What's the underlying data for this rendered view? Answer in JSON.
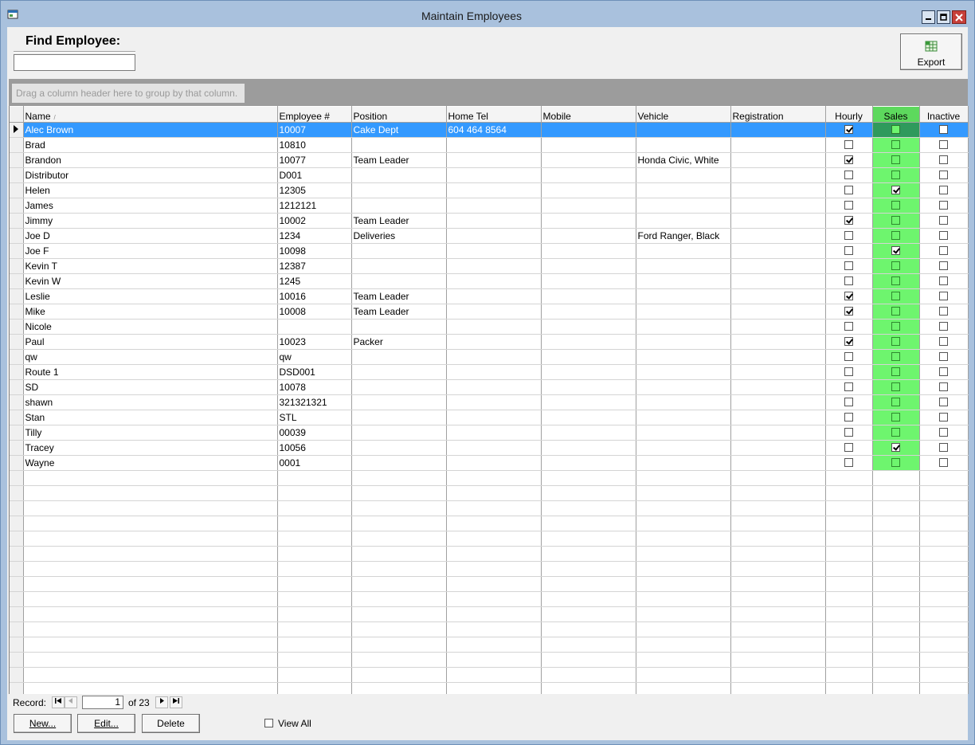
{
  "window": {
    "title": "Maintain Employees",
    "app_icon": "app-window-icon"
  },
  "find": {
    "label": "Find Employee:",
    "value": ""
  },
  "export": {
    "label": "Export",
    "icon": "spreadsheet-export-icon"
  },
  "group_hint": "Drag a column header here to group by that column.",
  "columns": {
    "name": "Name",
    "emp": "Employee #",
    "position": "Position",
    "home": "Home Tel",
    "mobile": "Mobile",
    "vehicle": "Vehicle",
    "registration": "Registration",
    "hourly": "Hourly",
    "sales": "Sales",
    "inactive": "Inactive"
  },
  "sort": {
    "column": "Name",
    "direction": "ascending"
  },
  "rows": [
    {
      "name": "Alec Brown",
      "emp": "10007",
      "position": "Cake Dept",
      "home": "604 464 8564",
      "mobile": "",
      "vehicle": "",
      "registration": "",
      "hourly": true,
      "sales": false,
      "inactive": false,
      "selected": true
    },
    {
      "name": "Brad",
      "emp": "10810",
      "position": "",
      "home": "",
      "mobile": "",
      "vehicle": "",
      "registration": "",
      "hourly": false,
      "sales": false,
      "inactive": false
    },
    {
      "name": "Brandon",
      "emp": "10077",
      "position": "Team Leader",
      "home": "",
      "mobile": "",
      "vehicle": "Honda Civic, White",
      "registration": "",
      "hourly": true,
      "sales": false,
      "inactive": false
    },
    {
      "name": "Distributor",
      "emp": "D001",
      "position": "",
      "home": "",
      "mobile": "",
      "vehicle": "",
      "registration": "",
      "hourly": false,
      "sales": false,
      "inactive": false
    },
    {
      "name": "Helen",
      "emp": "12305",
      "position": "",
      "home": "",
      "mobile": "",
      "vehicle": "",
      "registration": "",
      "hourly": false,
      "sales": true,
      "inactive": false
    },
    {
      "name": "James",
      "emp": "1212121",
      "position": "",
      "home": "",
      "mobile": "",
      "vehicle": "",
      "registration": "",
      "hourly": false,
      "sales": false,
      "inactive": false
    },
    {
      "name": "Jimmy",
      "emp": "10002",
      "position": "Team Leader",
      "home": "",
      "mobile": "",
      "vehicle": "",
      "registration": "",
      "hourly": true,
      "sales": false,
      "inactive": false
    },
    {
      "name": "Joe D",
      "emp": "1234",
      "position": "Deliveries",
      "home": "",
      "mobile": "",
      "vehicle": "Ford Ranger, Black",
      "registration": "",
      "hourly": false,
      "sales": false,
      "inactive": false
    },
    {
      "name": "Joe F",
      "emp": "10098",
      "position": "",
      "home": "",
      "mobile": "",
      "vehicle": "",
      "registration": "",
      "hourly": false,
      "sales": true,
      "inactive": false
    },
    {
      "name": "Kevin T",
      "emp": "12387",
      "position": "",
      "home": "",
      "mobile": "",
      "vehicle": "",
      "registration": "",
      "hourly": false,
      "sales": false,
      "inactive": false
    },
    {
      "name": "Kevin W",
      "emp": "1245",
      "position": "",
      "home": "",
      "mobile": "",
      "vehicle": "",
      "registration": "",
      "hourly": false,
      "sales": false,
      "inactive": false
    },
    {
      "name": "Leslie",
      "emp": "10016",
      "position": "Team Leader",
      "home": "",
      "mobile": "",
      "vehicle": "",
      "registration": "",
      "hourly": true,
      "sales": false,
      "inactive": false
    },
    {
      "name": "Mike",
      "emp": "10008",
      "position": "Team Leader",
      "home": "",
      "mobile": "",
      "vehicle": "",
      "registration": "",
      "hourly": true,
      "sales": false,
      "inactive": false
    },
    {
      "name": "Nicole",
      "emp": "",
      "position": "",
      "home": "",
      "mobile": "",
      "vehicle": "",
      "registration": "",
      "hourly": false,
      "sales": false,
      "inactive": false
    },
    {
      "name": "Paul",
      "emp": "10023",
      "position": "Packer",
      "home": "",
      "mobile": "",
      "vehicle": "",
      "registration": "",
      "hourly": true,
      "sales": false,
      "inactive": false
    },
    {
      "name": "qw",
      "emp": "qw",
      "position": "",
      "home": "",
      "mobile": "",
      "vehicle": "",
      "registration": "",
      "hourly": false,
      "sales": false,
      "inactive": false
    },
    {
      "name": "Route 1",
      "emp": "DSD001",
      "position": "",
      "home": "",
      "mobile": "",
      "vehicle": "",
      "registration": "",
      "hourly": false,
      "sales": false,
      "inactive": false
    },
    {
      "name": "SD",
      "emp": "10078",
      "position": "",
      "home": "",
      "mobile": "",
      "vehicle": "",
      "registration": "",
      "hourly": false,
      "sales": false,
      "inactive": false
    },
    {
      "name": "shawn",
      "emp": "321321321",
      "position": "",
      "home": "",
      "mobile": "",
      "vehicle": "",
      "registration": "",
      "hourly": false,
      "sales": false,
      "inactive": false
    },
    {
      "name": "Stan",
      "emp": "STL",
      "position": "",
      "home": "",
      "mobile": "",
      "vehicle": "",
      "registration": "",
      "hourly": false,
      "sales": false,
      "inactive": false
    },
    {
      "name": "Tilly",
      "emp": "00039",
      "position": "",
      "home": "",
      "mobile": "",
      "vehicle": "",
      "registration": "",
      "hourly": false,
      "sales": false,
      "inactive": false
    },
    {
      "name": "Tracey",
      "emp": "10056",
      "position": "",
      "home": "",
      "mobile": "",
      "vehicle": "",
      "registration": "",
      "hourly": false,
      "sales": true,
      "inactive": false
    },
    {
      "name": "Wayne",
      "emp": "0001",
      "position": "",
      "home": "",
      "mobile": "",
      "vehicle": "",
      "registration": "",
      "hourly": false,
      "sales": false,
      "inactive": false
    }
  ],
  "navigator": {
    "label": "Record:",
    "current": "1",
    "total": "of 23"
  },
  "buttons": {
    "new": "New...",
    "edit": "Edit...",
    "delete": "Delete"
  },
  "view_all": {
    "label": "View All",
    "checked": false
  },
  "colors": {
    "sales_column": "#6ef56e",
    "selection": "#3399ff",
    "titlebar": "#a9c1dd"
  }
}
